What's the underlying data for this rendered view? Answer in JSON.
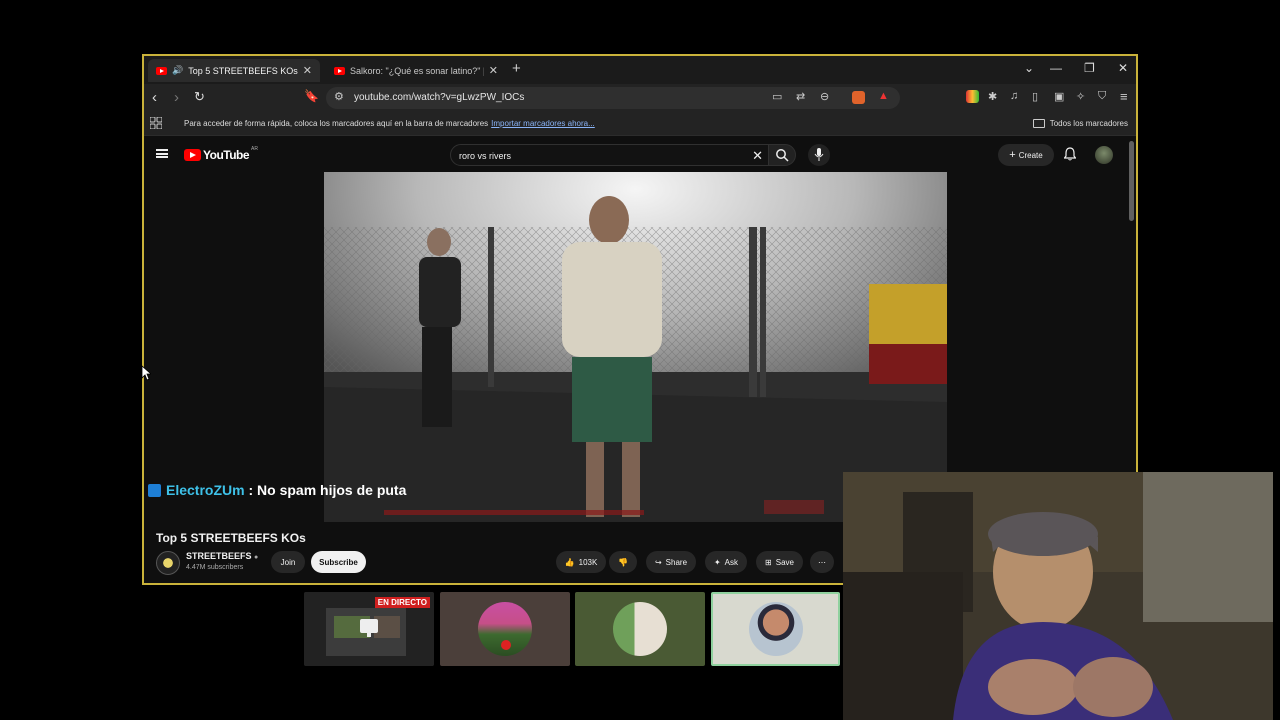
{
  "browser": {
    "tabs": [
      {
        "title": "Top 5 STREETBEEFS KOs - You",
        "active": true
      },
      {
        "title": "Salkoro: \"¿Qué es sonar latino?\" | Ent",
        "active": false
      }
    ],
    "url": "youtube.com/watch?v=gLwzPW_IOCs",
    "bookmarks_bar": {
      "hint": "Para acceder de forma rápida, coloca los marcadores aquí en la barra de marcadores",
      "import_link": "Importar marcadores ahora...",
      "all_bookmarks": "Todos los marcadores"
    }
  },
  "youtube": {
    "logo_text": "YouTube",
    "logo_country": "AR",
    "search_query": "roro vs rivers",
    "create_label": "Create",
    "video": {
      "title": "Top 5 STREETBEEFS KOs",
      "channel": "STREETBEEFS",
      "subscribers": "4.47M subscribers",
      "likes": "103K",
      "join_label": "Join",
      "subscribe_label": "Subscribe",
      "share_label": "Share",
      "ask_label": "Ask",
      "save_label": "Save"
    }
  },
  "chat_overlay": {
    "user": "ElectroZUm",
    "message": " : No spam hijos de puta"
  },
  "thumbnails": {
    "live_label": "EN DIRECTO"
  },
  "colors": {
    "window_border": "#c9b23a",
    "yt_red": "#ff0000",
    "chat_user": "#3ec1e8",
    "live_badge": "#d01f1f"
  }
}
